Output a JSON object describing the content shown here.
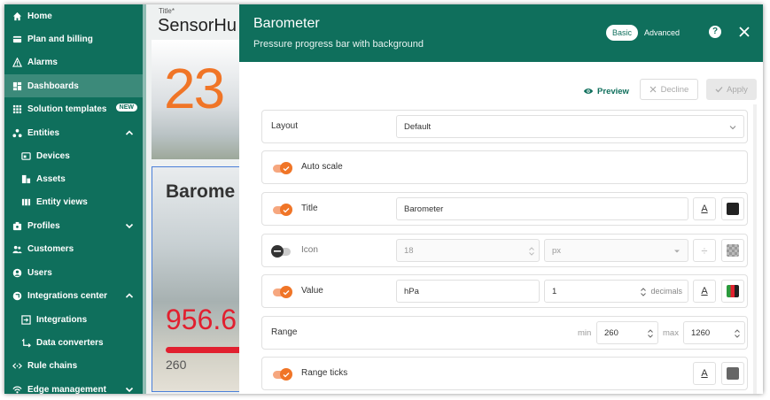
{
  "sidebar": {
    "items": [
      {
        "label": "Home",
        "icon": "home-icon"
      },
      {
        "label": "Plan and billing",
        "icon": "billing-icon"
      },
      {
        "label": "Alarms",
        "icon": "warning-icon"
      },
      {
        "label": "Dashboards",
        "icon": "dashboard-icon"
      },
      {
        "label": "Solution templates",
        "icon": "grid-icon",
        "badge": "NEW"
      },
      {
        "label": "Entities",
        "icon": "entities-icon"
      },
      {
        "label": "Devices",
        "icon": "device-icon"
      },
      {
        "label": "Assets",
        "icon": "assets-icon"
      },
      {
        "label": "Entity views",
        "icon": "entity-views-icon"
      },
      {
        "label": "Profiles",
        "icon": "profiles-icon"
      },
      {
        "label": "Customers",
        "icon": "customers-icon"
      },
      {
        "label": "Users",
        "icon": "user-icon"
      },
      {
        "label": "Integrations center",
        "icon": "integrations-icon"
      },
      {
        "label": "Integrations",
        "icon": "integration-icon"
      },
      {
        "label": "Data converters",
        "icon": "converter-icon"
      },
      {
        "label": "Rule chains",
        "icon": "rule-chain-icon"
      },
      {
        "label": "Edge management",
        "icon": "edge-icon"
      }
    ]
  },
  "dashboard": {
    "title_label": "Title*",
    "title": "SensorHu",
    "card1_value": "23",
    "card2_title": "Barome",
    "card2_value": "956.6",
    "card2_min": "260"
  },
  "dialog": {
    "title": "Barometer",
    "subtitle": "Pressure progress bar with background",
    "mode_basic": "Basic",
    "mode_advanced": "Advanced",
    "help": "?",
    "preview": "Preview",
    "decline": "Decline",
    "apply": "Apply",
    "layout": {
      "label": "Layout",
      "value": "Default"
    },
    "auto_scale": {
      "label": "Auto scale"
    },
    "title_row": {
      "label": "Title",
      "value": "Barometer",
      "font_glyph": "A",
      "color": "#222222"
    },
    "icon_row": {
      "label": "Icon",
      "size": "18",
      "unit": "px",
      "font_glyph": "÷"
    },
    "value_row": {
      "label": "Value",
      "units": "hPa",
      "decimals": "1",
      "decimals_label": "decimals",
      "font_glyph": "A"
    },
    "range_row": {
      "label": "Range",
      "min_label": "min",
      "min": "260",
      "max_label": "max",
      "max": "1260"
    },
    "ticks_row": {
      "label": "Range ticks",
      "font_glyph": "A",
      "color": "#666666"
    }
  },
  "colors": {
    "primary": "#0f6f5c",
    "accent": "#f07527",
    "value_red": "#e1202f"
  }
}
